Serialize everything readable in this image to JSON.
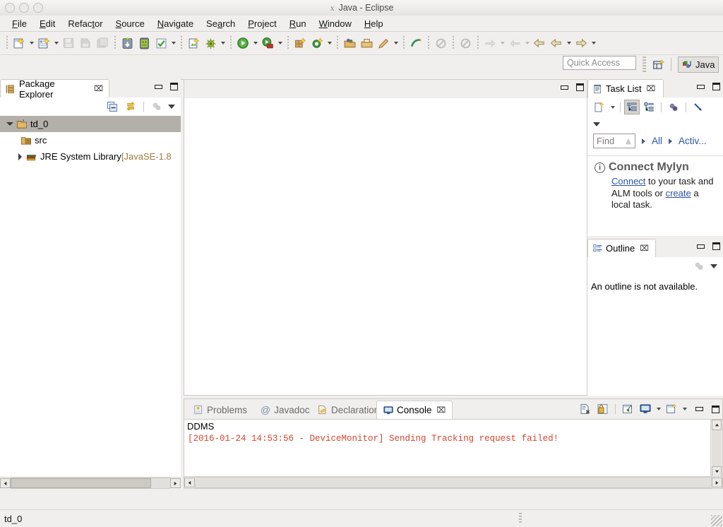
{
  "window": {
    "title": "Java - Eclipse",
    "icon": "x11-icon",
    "controls": [
      "minimize",
      "maximize",
      "close"
    ]
  },
  "menubar": {
    "items": [
      {
        "label": "File",
        "mnemonic": "F"
      },
      {
        "label": "Edit",
        "mnemonic": "E"
      },
      {
        "label": "Refactor",
        "mnemonic": "t"
      },
      {
        "label": "Source",
        "mnemonic": "S"
      },
      {
        "label": "Navigate",
        "mnemonic": "N"
      },
      {
        "label": "Search",
        "mnemonic": "a"
      },
      {
        "label": "Project",
        "mnemonic": "P"
      },
      {
        "label": "Run",
        "mnemonic": "R"
      },
      {
        "label": "Window",
        "mnemonic": "W"
      },
      {
        "label": "Help",
        "mnemonic": "H"
      }
    ]
  },
  "toolbar": {
    "groups": [
      {
        "items": [
          {
            "name": "new-wizard-icon",
            "enabled": true,
            "dropdown": true
          },
          {
            "name": "new-java-class-icon",
            "enabled": true,
            "dropdown": true
          },
          {
            "name": "save-icon",
            "enabled": false,
            "dropdown": false
          },
          {
            "name": "save-as-icon",
            "enabled": false,
            "dropdown": false
          },
          {
            "name": "save-all-icon",
            "enabled": false,
            "dropdown": false
          }
        ]
      },
      {
        "items": [
          {
            "name": "android-sdk-manager-icon",
            "enabled": true,
            "dropdown": false
          },
          {
            "name": "android-virtual-device-manager-icon",
            "enabled": true,
            "dropdown": false
          },
          {
            "name": "run-lint-icon",
            "enabled": true,
            "dropdown": true
          }
        ]
      },
      {
        "items": [
          {
            "name": "new-android-project-icon",
            "enabled": true,
            "dropdown": false
          },
          {
            "name": "debug-icon",
            "enabled": true,
            "dropdown": true
          }
        ]
      },
      {
        "items": [
          {
            "name": "run-icon",
            "enabled": true,
            "dropdown": true
          },
          {
            "name": "run-external-tools-icon",
            "enabled": true,
            "dropdown": true
          }
        ]
      },
      {
        "items": [
          {
            "name": "new-package-icon",
            "enabled": true,
            "dropdown": false
          },
          {
            "name": "new-class-icon",
            "enabled": true,
            "dropdown": true
          }
        ]
      },
      {
        "items": [
          {
            "name": "open-type-icon",
            "enabled": true,
            "dropdown": false
          },
          {
            "name": "open-task-icon",
            "enabled": true,
            "dropdown": false
          },
          {
            "name": "pencil-icon",
            "enabled": true,
            "dropdown": true
          }
        ]
      },
      {
        "items": [
          {
            "name": "next-annotation-icon",
            "enabled": true,
            "dropdown": false
          },
          {
            "name": "previous-annotation-icon",
            "enabled": false,
            "dropdown": false
          }
        ]
      },
      {
        "items": [
          {
            "name": "last-edit-location-icon",
            "enabled": false,
            "dropdown": false
          }
        ]
      },
      {
        "items": [
          {
            "name": "back-history-icon",
            "enabled": false,
            "dropdown": true
          },
          {
            "name": "forward-history-icon",
            "enabled": false,
            "dropdown": true
          },
          {
            "name": "previous-edit-icon",
            "enabled": true,
            "dropdown": false
          },
          {
            "name": "back-arrow-icon",
            "enabled": true,
            "dropdown": true
          },
          {
            "name": "forward-arrow-icon",
            "enabled": true,
            "dropdown": true
          }
        ]
      }
    ]
  },
  "quick_access": {
    "placeholder": "Quick Access",
    "value": "",
    "open_perspective_icon": "open-perspective-icon",
    "perspectives": [
      {
        "label": "Java",
        "icon": "java-perspective-icon",
        "active": true
      }
    ]
  },
  "package_explorer": {
    "tab_label": "Package Explorer",
    "tab_icon": "package-explorer-icon",
    "close_glyph": "⌧",
    "toolbar": [
      {
        "name": "collapse-all-icon",
        "enabled": true
      },
      {
        "name": "link-with-editor-icon",
        "enabled": true
      },
      {
        "name": "focus-on-active-task-icon",
        "enabled": false
      },
      {
        "name": "view-menu-icon",
        "enabled": true
      }
    ],
    "tree": [
      {
        "label": "td_0",
        "icon": "java-project-icon",
        "indent": 0,
        "twisty": "open",
        "selected": true,
        "suffix": ""
      },
      {
        "label": "src",
        "icon": "source-folder-icon",
        "indent": 1,
        "twisty": "none",
        "selected": false,
        "suffix": ""
      },
      {
        "label": "JRE System Library",
        "icon": "jre-library-icon",
        "indent": 1,
        "twisty": "closed",
        "selected": false,
        "suffix": " [JavaSE-1.8"
      }
    ],
    "hscroll": {
      "thumb_percent": 88
    }
  },
  "editor_area": {
    "empty": true,
    "controls": [
      "minimize",
      "maximize"
    ]
  },
  "task_list": {
    "tab_label": "Task List",
    "tab_icon": "task-list-icon",
    "close_glyph": "⌧",
    "toolbar": [
      {
        "name": "new-task-icon",
        "enabled": true,
        "dropdown": true
      },
      {
        "name": "categorized-presentation-icon",
        "enabled": true,
        "toggled": true
      },
      {
        "name": "scheduled-presentation-icon",
        "enabled": true
      },
      {
        "name": "focus-on-workweek-icon",
        "enabled": true
      },
      {
        "name": "collapse-all-icon",
        "enabled": true
      },
      {
        "name": "view-menu-icon",
        "enabled": true
      }
    ],
    "find": {
      "placeholder": "Find",
      "value": "",
      "clear_icon": "find-clear-icon"
    },
    "filters": [
      {
        "label": "All"
      },
      {
        "label": "Activ..."
      }
    ],
    "mylyn": {
      "icon": "info-icon",
      "title": "Connect Mylyn",
      "link1": "Connect",
      "text1": " to your task and",
      "text2": "ALM tools or ",
      "link2": "create",
      "text3": " a",
      "text4": "local task."
    },
    "controls": [
      "minimize",
      "maximize"
    ]
  },
  "outline": {
    "tab_label": "Outline",
    "tab_icon": "outline-icon",
    "close_glyph": "⌧",
    "toolbar": [
      {
        "name": "focus-on-active-task-icon",
        "enabled": false
      },
      {
        "name": "view-menu-icon",
        "enabled": true
      }
    ],
    "message": "An outline is not available.",
    "controls": [
      "minimize",
      "maximize"
    ]
  },
  "console": {
    "tabs": [
      {
        "label": "Problems",
        "icon": "problems-icon",
        "active": false
      },
      {
        "label": "Javadoc",
        "icon": "javadoc-icon",
        "active": false
      },
      {
        "label": "Declaration",
        "icon": "declaration-icon",
        "active": false
      },
      {
        "label": "Console",
        "icon": "console-icon",
        "active": true,
        "close_glyph": "⌧"
      }
    ],
    "toolbar": [
      {
        "name": "clear-console-icon",
        "enabled": true
      },
      {
        "name": "scroll-lock-icon",
        "enabled": true
      },
      {
        "name": "pin-console-icon",
        "enabled": true
      },
      {
        "name": "display-selected-console-icon",
        "enabled": true,
        "dropdown": true
      },
      {
        "name": "open-console-icon",
        "enabled": true,
        "dropdown": true
      }
    ],
    "controls": [
      "minimize",
      "maximize"
    ],
    "source_label": "DDMS",
    "lines": [
      {
        "text": "[2016-01-24 14:53:56 - DeviceMonitor] Sending Tracking request failed!",
        "color": "#d9432f"
      }
    ],
    "hscroll": {
      "thumb_percent": 0
    }
  },
  "status_bar": {
    "text": "td_0"
  },
  "colors": {
    "chrome": "#f0efee",
    "panel_bg": "#ffffff",
    "selection": "#b3b0a9",
    "link": "#2b53a8",
    "error_text": "#d9432f",
    "border": "#cfccc7"
  }
}
